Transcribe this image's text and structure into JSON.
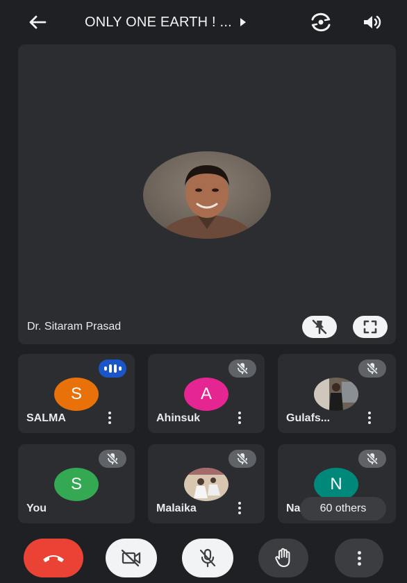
{
  "header": {
    "title": "ONLY ONE EARTH ! ...",
    "icons": {
      "back": "arrow-left-icon",
      "play": "play-arrow-icon",
      "switch_camera": "switch-camera-icon",
      "speaker": "speaker-icon"
    }
  },
  "main": {
    "name": "Dr. Sitaram Prasad",
    "icons": {
      "unpin": "unpin-icon",
      "fullscreen": "fullscreen-icon"
    }
  },
  "tiles": [
    {
      "name": "SALMA",
      "initial": "S",
      "color": "#e8710a",
      "status": "speaking"
    },
    {
      "name": "Ahinsuk",
      "initial": "A",
      "color": "#e52592",
      "status": "muted"
    },
    {
      "name": "Gulafs...",
      "initial": "",
      "color": "",
      "status": "muted",
      "photo": true
    },
    {
      "name": "You",
      "initial": "S",
      "color": "#34a853",
      "status": "muted"
    },
    {
      "name": "Malaika",
      "initial": "",
      "color": "",
      "status": "muted",
      "photo": true
    },
    {
      "name": "Na",
      "initial": "N",
      "color": "#00897b",
      "status": "muted"
    }
  ],
  "others": {
    "label": "60 others"
  },
  "controls": {
    "end_call_color": "#ea4335",
    "icons": {
      "end_call": "phone-hangup-icon",
      "camera": "camera-off-icon",
      "mic": "mic-off-icon",
      "hand": "raise-hand-icon",
      "more": "more-vertical-icon"
    }
  }
}
